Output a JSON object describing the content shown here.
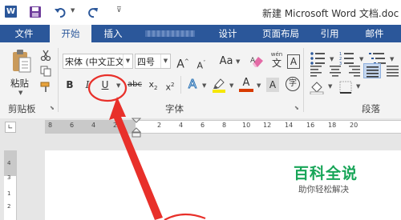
{
  "title_bar": {
    "word_icon_label": "W",
    "title": "新建 Microsoft Word 文档.doc"
  },
  "tabs": [
    {
      "label": "文件"
    },
    {
      "label": "开始"
    },
    {
      "label": "插入"
    },
    {
      "label": ""
    },
    {
      "label": "设计"
    },
    {
      "label": "页面布局"
    },
    {
      "label": "引用"
    },
    {
      "label": "邮件"
    }
  ],
  "clipboard": {
    "paste_label": "粘贴",
    "group_label": "剪贴板"
  },
  "font": {
    "font_name": "宋体 (中文正文",
    "font_size": "四号",
    "grow": "A",
    "shrink": "A",
    "case": "Aa",
    "pinyin_top": "wén",
    "pinyin_char": "文",
    "bold": "B",
    "italic": "I",
    "underline": "U",
    "strike": "abc",
    "subscript": "x",
    "subscript_mark": "2",
    "superscript": "x",
    "superscript_mark": "2",
    "effects": "A",
    "color": "A",
    "enclose": "字",
    "group_label": "字体"
  },
  "paragraph": {
    "group_label": "段落"
  },
  "ruler": {
    "marks": [
      "8",
      "6",
      "4",
      "2",
      "2",
      "4",
      "6",
      "8",
      "10",
      "12",
      "14",
      "16",
      "18",
      "20"
    ]
  },
  "vertical_ruler": {
    "marks": [
      "4",
      "3",
      "1",
      "2"
    ]
  },
  "watermark": {
    "title": "百科全说",
    "subtitle": "助你轻松解决"
  },
  "colors": {
    "accent": "#2b579a",
    "annotation": "#e8302a",
    "highlight": "#f6e700",
    "font_color": "#d83b01"
  }
}
